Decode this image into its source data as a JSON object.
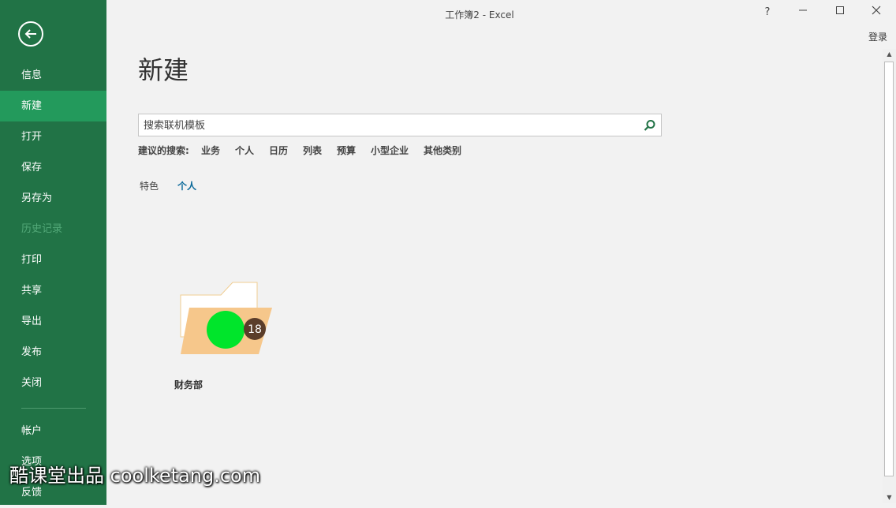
{
  "window": {
    "title": "工作簿2 - Excel",
    "help": "?",
    "minimize": "—",
    "maximize": "☐",
    "close": "✕",
    "signin": "登录"
  },
  "sidebar": {
    "items": [
      {
        "label": "信息"
      },
      {
        "label": "新建"
      },
      {
        "label": "打开"
      },
      {
        "label": "保存"
      },
      {
        "label": "另存为"
      },
      {
        "label": "历史记录"
      },
      {
        "label": "打印"
      },
      {
        "label": "共享"
      },
      {
        "label": "导出"
      },
      {
        "label": "发布"
      },
      {
        "label": "关闭"
      },
      {
        "label": "帐户"
      },
      {
        "label": "选项"
      },
      {
        "label": "反馈"
      }
    ]
  },
  "main": {
    "title": "新建",
    "search": {
      "placeholder": "搜索联机模板"
    },
    "suggestions": {
      "label": "建议的搜索:",
      "items": [
        "业务",
        "个人",
        "日历",
        "列表",
        "预算",
        "小型企业",
        "其他类别"
      ]
    },
    "tabs": [
      "特色",
      "个人"
    ],
    "folder": {
      "label": "财务部",
      "badge": "18"
    }
  },
  "colors": {
    "accent": "#217346",
    "active_tab": "#0b6a9a",
    "folder": "#f6c78b",
    "dot": "#00e52b"
  },
  "watermark": "酷课堂出品 coolketang.com"
}
